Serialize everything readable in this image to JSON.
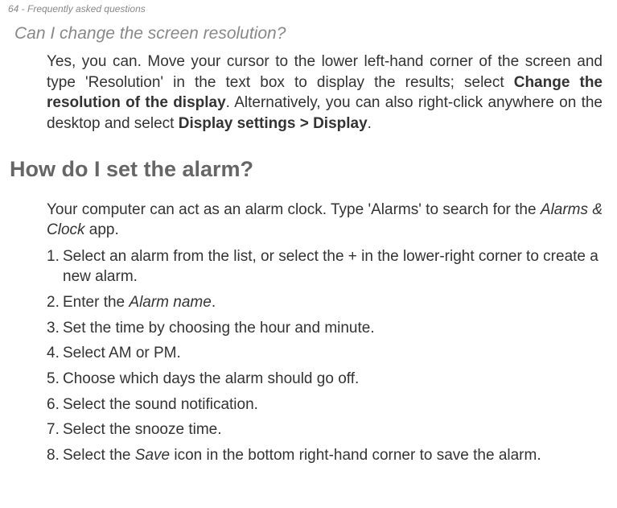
{
  "header": "64 - Frequently asked questions",
  "q1": {
    "heading": "Can I change the screen resolution?",
    "answer_part1": "Yes, you can. Move your cursor to the lower left-hand corner of the screen and type 'Resolution' in the text box to display the results; select ",
    "answer_bold1": "Change the resolution of the display",
    "answer_part2": ". Alternatively, you can also right-click anywhere on the desktop and select ",
    "answer_bold2": "Display settings > Display",
    "answer_part3": "."
  },
  "q2": {
    "heading": "How do I set the alarm?",
    "intro_part1": "Your computer can act as an alarm clock. Type 'Alarms' to search for the ",
    "intro_italic": "Alarms & Clock",
    "intro_part2": " app.",
    "steps": {
      "s1": "Select an alarm from the list, or select the + in the lower-right corner to create a new alarm.",
      "s2a": "Enter the ",
      "s2b": "Alarm name",
      "s2c": ".",
      "s3": "Set the time by choosing the hour and minute.",
      "s4": "Select AM or PM.",
      "s5": "Choose which days the alarm should go off.",
      "s6": "Select the sound notification.",
      "s7": "Select the snooze time.",
      "s8a": "Select the ",
      "s8b": "Save",
      "s8c": " icon in the bottom right-hand corner to save the alarm."
    }
  }
}
